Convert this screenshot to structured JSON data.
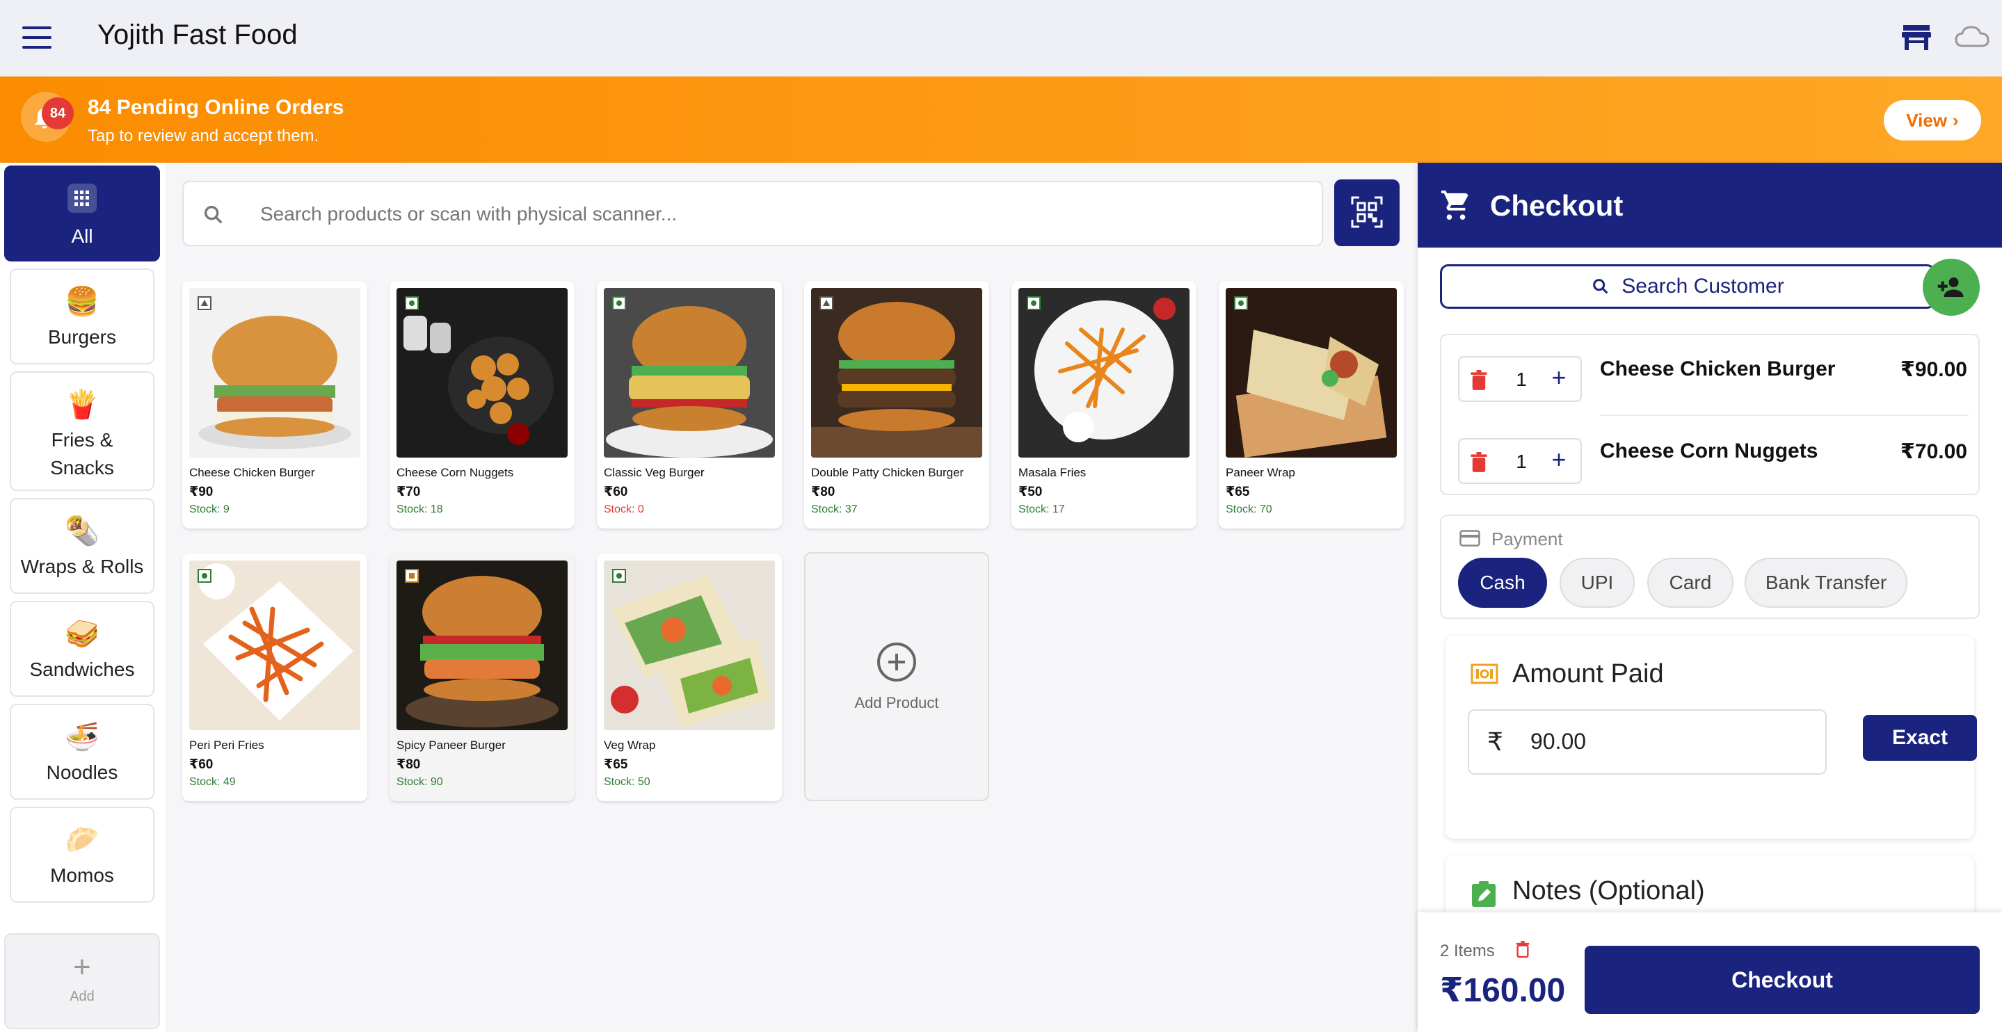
{
  "app": {
    "title": "Yojith Fast Food"
  },
  "banner": {
    "badge": "84",
    "title": "84 Pending Online Orders",
    "subtitle": "Tap to review and accept them.",
    "view_label": "View"
  },
  "categories": [
    {
      "label": "All",
      "icon": "grid-icon",
      "active": true
    },
    {
      "label": "Burgers",
      "icon": "burger-icon"
    },
    {
      "label": "Fries & Snacks",
      "icon": "fries-icon"
    },
    {
      "label": "Wraps & Rolls",
      "icon": "wrap-icon"
    },
    {
      "label": "Sandwiches",
      "icon": "sandwich-icon"
    },
    {
      "label": "Noodles",
      "icon": "noodles-icon"
    },
    {
      "label": "Momos",
      "icon": "momos-icon"
    }
  ],
  "add_category_label": "Add",
  "search": {
    "placeholder": "Search products or scan with physical scanner..."
  },
  "products": [
    {
      "name": "Cheese Chicken Burger",
      "price": "₹90",
      "stock": "Stock: 9",
      "diet": "nonveg"
    },
    {
      "name": "Cheese Corn Nuggets",
      "price": "₹70",
      "stock": "Stock: 18",
      "diet": "veg"
    },
    {
      "name": "Classic Veg Burger",
      "price": "₹60",
      "stock": "Stock: 0",
      "diet": "veg"
    },
    {
      "name": "Double Patty Chicken Burger",
      "price": "₹80",
      "stock": "Stock: 37",
      "diet": "nonveg"
    },
    {
      "name": "Masala Fries",
      "price": "₹50",
      "stock": "Stock: 17",
      "diet": "veg"
    },
    {
      "name": "Paneer Wrap",
      "price": "₹65",
      "stock": "Stock: 70",
      "diet": "veg"
    },
    {
      "name": "Peri Peri Fries",
      "price": "₹60",
      "stock": "Stock: 49",
      "diet": "veg"
    },
    {
      "name": "Spicy Paneer Burger",
      "price": "₹80",
      "stock": "Stock: 90",
      "diet": "egg"
    },
    {
      "name": "Veg Wrap",
      "price": "₹65",
      "stock": "Stock: 50",
      "diet": "veg"
    }
  ],
  "add_product_label": "Add Product",
  "checkout": {
    "title": "Checkout",
    "search_customer_label": "Search Customer",
    "cart": [
      {
        "qty": "1",
        "name": "Cheese Chicken Burger",
        "price": "₹90.00"
      },
      {
        "qty": "1",
        "name": "Cheese Corn Nuggets",
        "price": "₹70.00"
      }
    ],
    "payment_label": "Payment",
    "payment_methods": [
      "Cash",
      "UPI",
      "Card",
      "Bank Transfer"
    ],
    "payment_selected": "Cash",
    "amount_paid_label": "Amount Paid",
    "currency_symbol": "₹",
    "amount_paid_value": "90.00",
    "exact_label": "Exact",
    "notes_label": "Notes (Optional)",
    "items_count": "2 Items",
    "total": "₹160.00",
    "checkout_button": "Checkout"
  },
  "colors": {
    "primary": "#1a237e",
    "banner": "#fb8c00",
    "success": "#4caf50",
    "danger": "#e53935"
  }
}
